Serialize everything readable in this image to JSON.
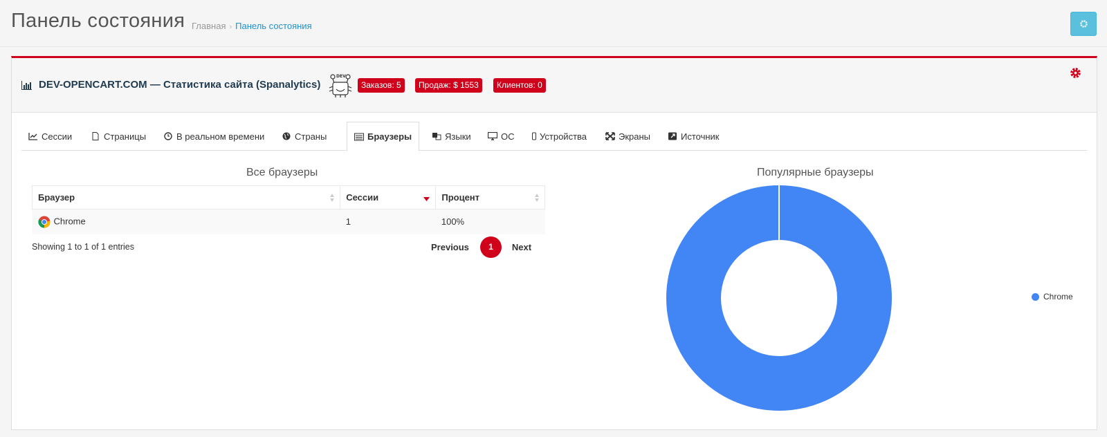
{
  "header": {
    "title": "Панель состояния",
    "breadcrumb": {
      "home": "Главная",
      "current": "Панель состояния"
    },
    "settings_icon": "gear-icon"
  },
  "panel": {
    "title": "DEV-OPENCART.COM — Статистика сайта (Spanalytics)",
    "logo_text": "DEV",
    "badges": {
      "orders": "Заказов: 5",
      "sales": "Продаж: $ 1553",
      "clients": "Клиентов: 0"
    },
    "accent": "#d0021b"
  },
  "tabs": [
    {
      "label": "Сессии",
      "icon": "line-chart-icon"
    },
    {
      "label": "Страницы",
      "icon": "file-icon"
    },
    {
      "label": "В реальном времени",
      "icon": "clock-icon"
    },
    {
      "label": "Страны",
      "icon": "globe-icon"
    },
    {
      "label": "Браузеры",
      "icon": "list-icon"
    },
    {
      "label": "Языки",
      "icon": "language-icon"
    },
    {
      "label": "ОС",
      "icon": "desktop-icon"
    },
    {
      "label": "Устройства",
      "icon": "mobile-icon"
    },
    {
      "label": "Экраны",
      "icon": "expand-icon"
    },
    {
      "label": "Источник",
      "icon": "external-link-icon"
    }
  ],
  "browsers_table": {
    "title": "Все браузеры",
    "columns": [
      "Браузер",
      "Сессии",
      "Процент"
    ],
    "rows": [
      {
        "browser": "Chrome",
        "sessions": "1",
        "percent": "100%"
      }
    ],
    "info": "Showing 1 to 1 of 1 entries",
    "pagination": {
      "previous": "Previous",
      "page": "1",
      "next": "Next"
    }
  },
  "chart_data": {
    "type": "pie",
    "title": "Популярные браузеры",
    "categories": [
      "Chrome"
    ],
    "values": [
      1
    ],
    "colors": [
      "#4285f4"
    ],
    "donut": true,
    "legend": "right"
  }
}
